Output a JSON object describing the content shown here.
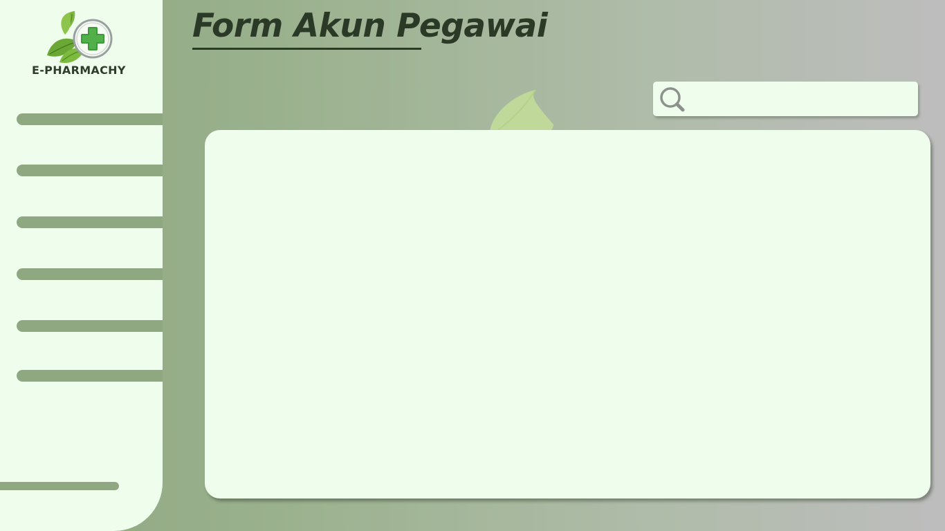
{
  "brand": {
    "name": "E-PHARMACHY",
    "logo_icon": "leaf-cross-logo-icon",
    "colors": {
      "accent_green": "#8fa882",
      "panel_bg": "#effded",
      "title_text": "#2b3a26"
    }
  },
  "header": {
    "title": "Form Akun Pegawai"
  },
  "search": {
    "icon": "search-icon",
    "value": "",
    "placeholder": ""
  },
  "sidebar": {
    "items": [
      {
        "label": ""
      },
      {
        "label": ""
      },
      {
        "label": ""
      },
      {
        "label": ""
      },
      {
        "label": ""
      },
      {
        "label": ""
      }
    ],
    "bottom_item": {
      "label": ""
    }
  },
  "main": {
    "panel_content": ""
  }
}
